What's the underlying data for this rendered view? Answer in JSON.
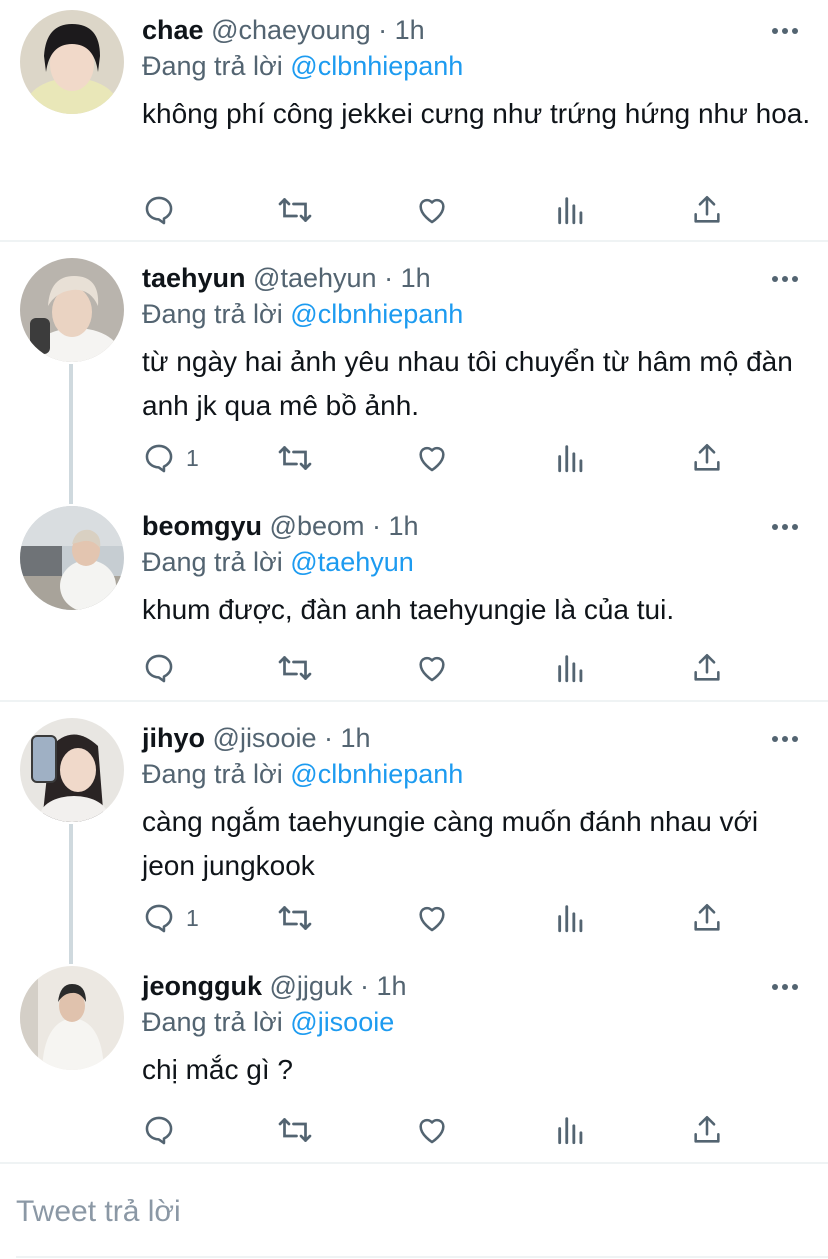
{
  "replying_label": "Đang trả lời",
  "tweets": [
    {
      "name": "chae",
      "handle": "@chaeyoung",
      "time": "1h",
      "reply_to": "@clbnhiepanh",
      "text": "không phí công jekkei cưng như trứng hứng như hoa.",
      "reply_count": ""
    },
    {
      "name": "taehyun",
      "handle": "@taehyun",
      "time": "1h",
      "reply_to": "@clbnhiepanh",
      "text": "từ ngày hai ảnh yêu nhau tôi chuyển từ hâm mộ đàn anh jk qua mê bồ ảnh.",
      "reply_count": "1"
    },
    {
      "name": "beomgyu",
      "handle": "@beom",
      "time": "1h",
      "reply_to": "@taehyun",
      "text": "khum được, đàn anh taehyungie là của tui.",
      "reply_count": ""
    },
    {
      "name": "jihyo",
      "handle": "@jisooie",
      "time": "1h",
      "reply_to": "@clbnhiepanh",
      "text": "càng ngắm taehyungie càng muốn đánh nhau với jeon jungkook",
      "reply_count": "1"
    },
    {
      "name": "jeongguk",
      "handle": "@jjguk",
      "time": "1h",
      "reply_to": "@jisooie",
      "text": "chị mắc gì ?",
      "reply_count": ""
    }
  ],
  "dot": "·",
  "compose_placeholder": "Tweet trả lời",
  "colors": {
    "link": "#1d9bf0",
    "muted": "#536471",
    "text": "#0f1419",
    "line": "#cfd9de"
  }
}
